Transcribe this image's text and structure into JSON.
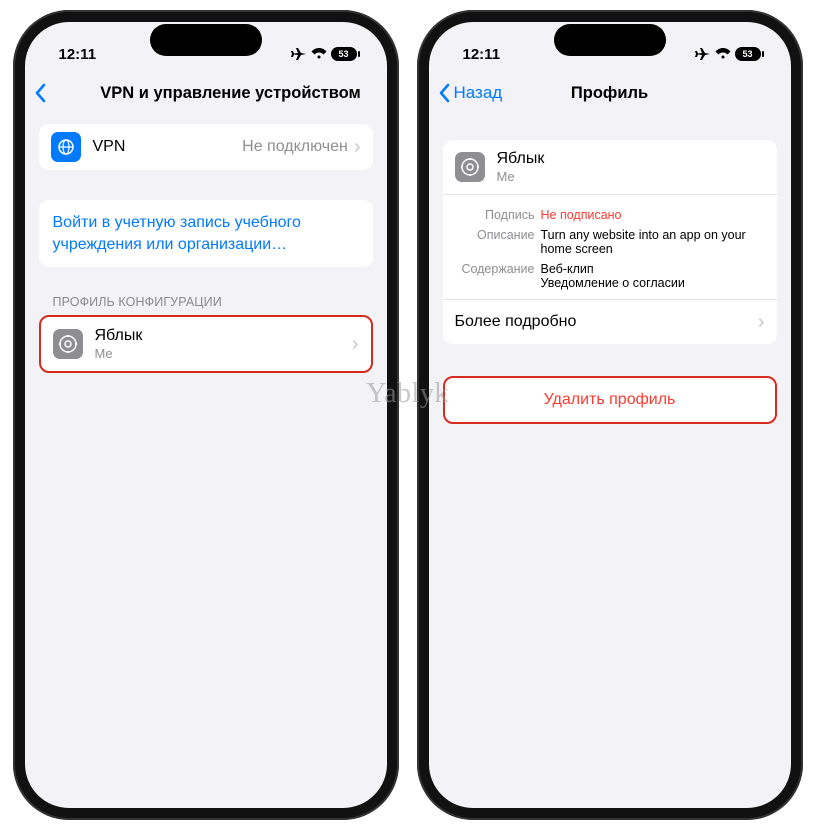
{
  "watermark": "Yablyk",
  "left": {
    "status": {
      "time": "12:11",
      "battery": "53"
    },
    "nav": {
      "title": "VPN и управление устройством"
    },
    "vpn": {
      "label": "VPN",
      "status": "Не подключен"
    },
    "signin": "Войти в учетную запись учебного учреждения или организации…",
    "section_header": "ПРОФИЛЬ КОНФИГУРАЦИИ",
    "profile_item": {
      "title": "Яблык",
      "subtitle": "Me"
    }
  },
  "right": {
    "status": {
      "time": "12:11",
      "battery": "53"
    },
    "nav": {
      "back": "Назад",
      "title": "Профиль"
    },
    "profile": {
      "title": "Яблык",
      "subtitle": "Me"
    },
    "details": {
      "sign_key": "Подпись",
      "sign_val": "Не подписано",
      "desc_key": "Описание",
      "desc_val": "Turn any website into an app on your home screen",
      "cont_key": "Содержание",
      "cont_val1": "Веб-клип",
      "cont_val2": "Уведомление о согласии"
    },
    "more": "Более подробно",
    "delete": "Удалить профиль"
  }
}
